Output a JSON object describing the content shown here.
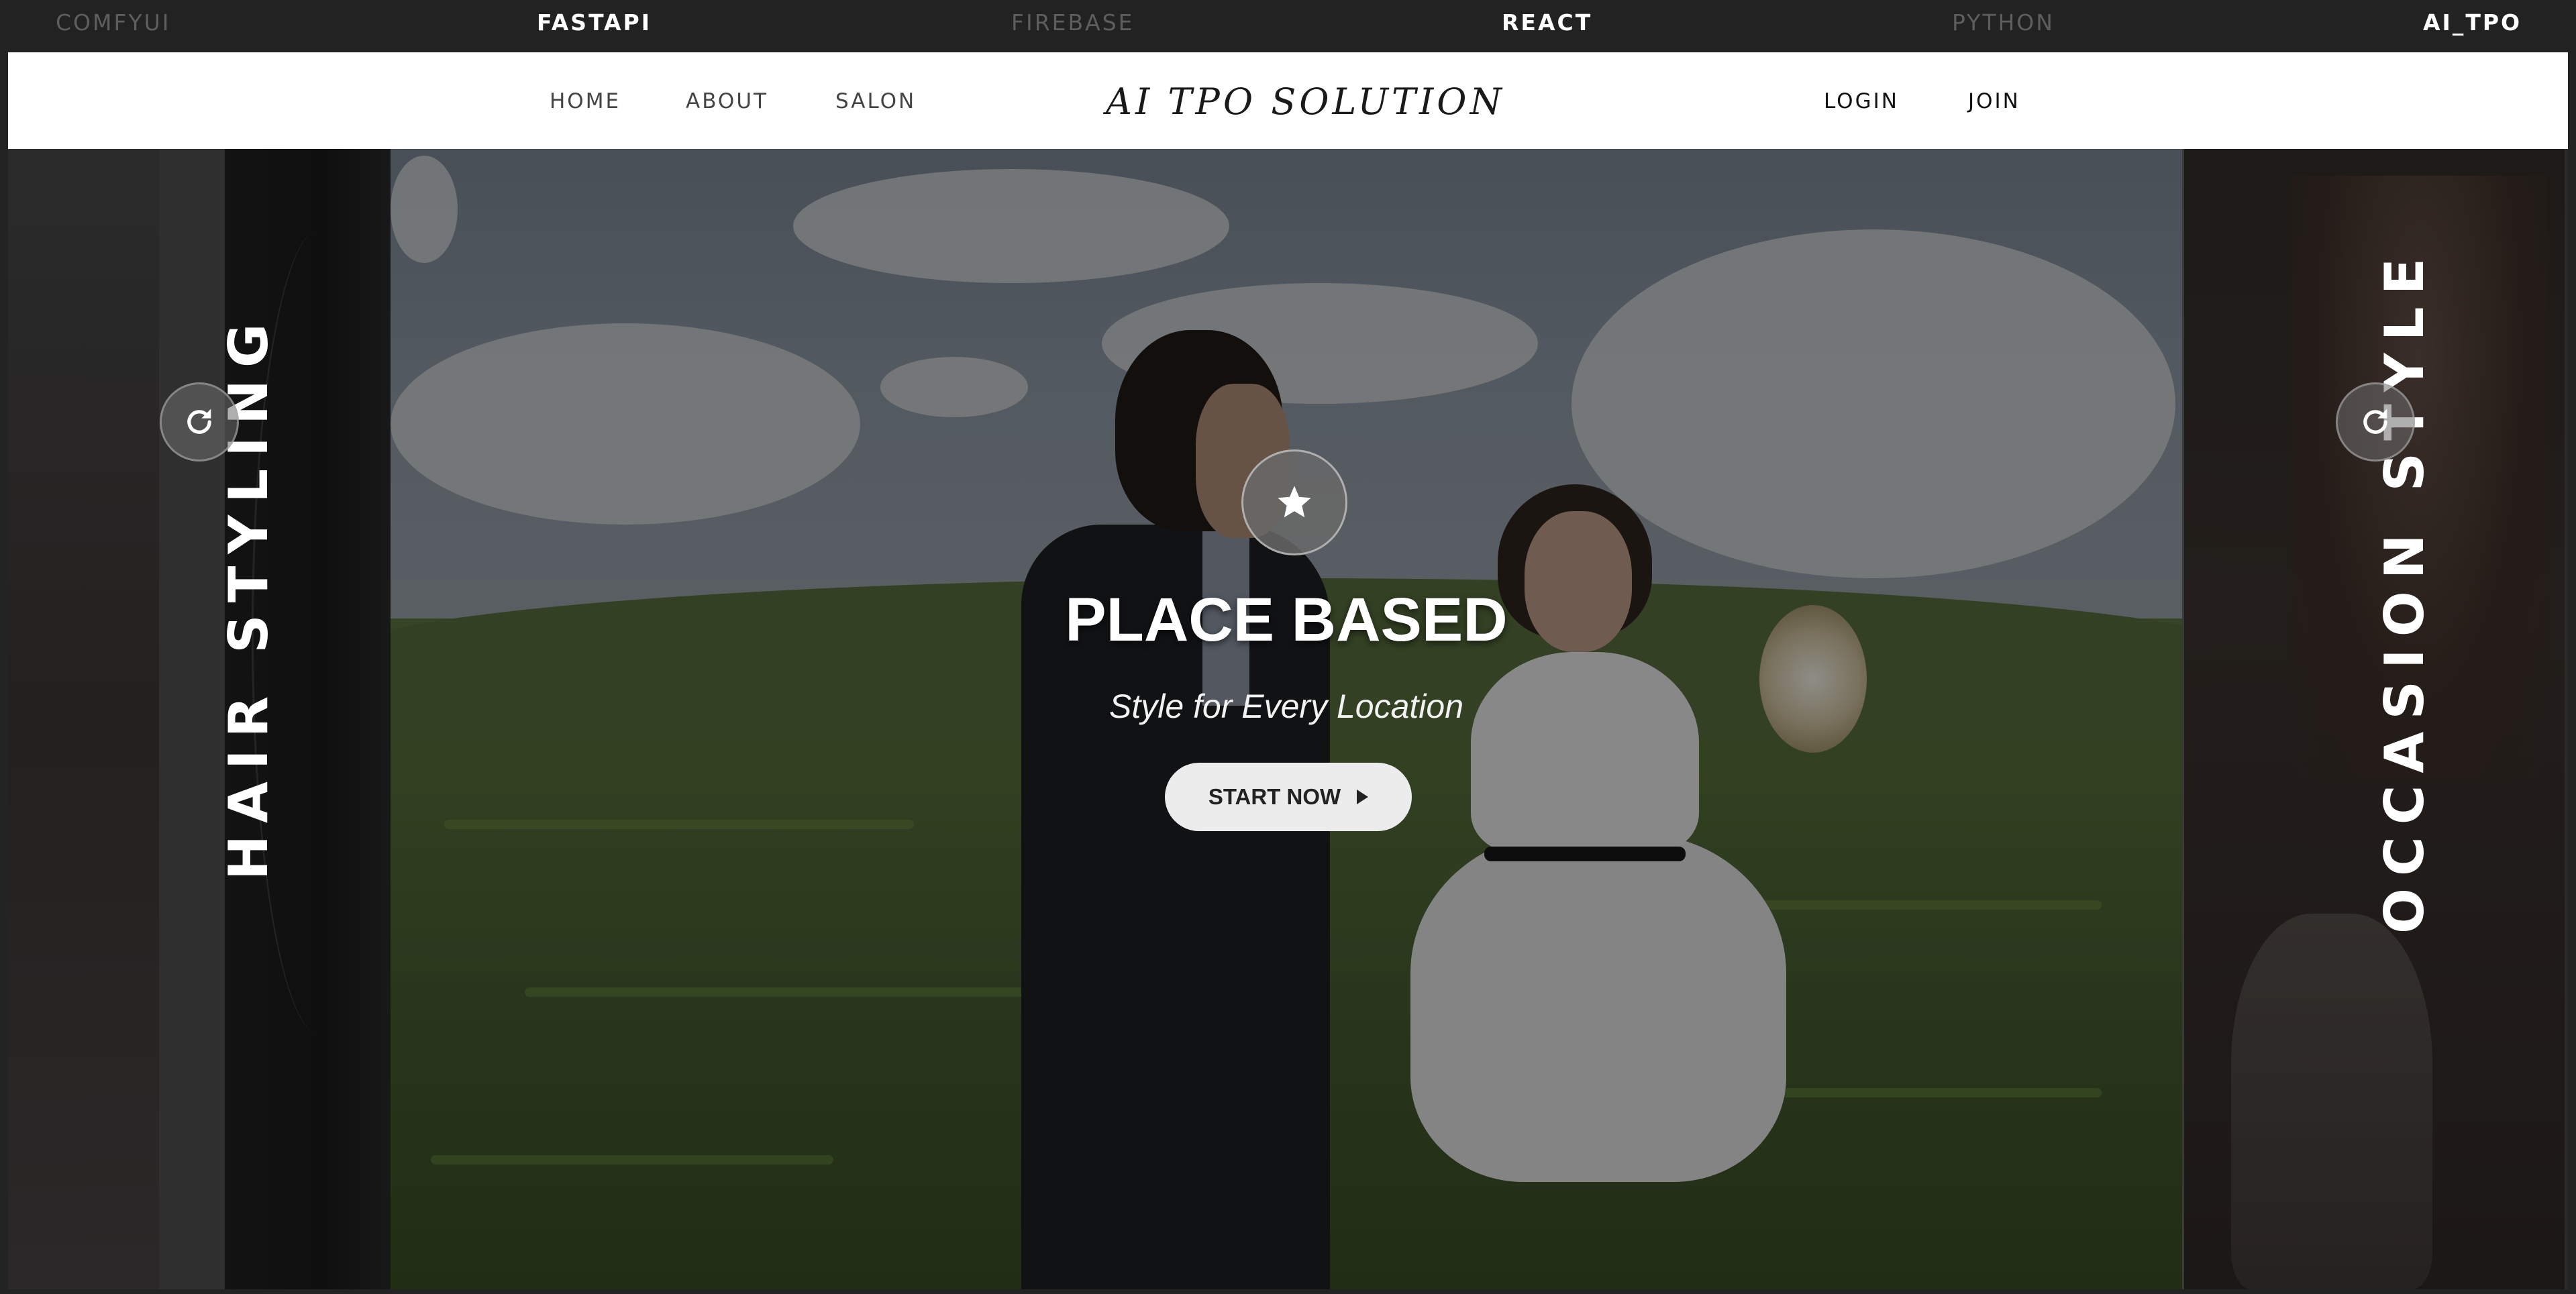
{
  "tech_strip": {
    "items": [
      {
        "label": "COMFYUI",
        "style": "dim"
      },
      {
        "label": "FASTAPI",
        "style": "bright"
      },
      {
        "label": "FIREBASE",
        "style": "dim"
      },
      {
        "label": "REACT",
        "style": "bright"
      },
      {
        "label": "PYTHON",
        "style": "dim"
      },
      {
        "label": "AI_TPO",
        "style": "bright"
      }
    ]
  },
  "navbar": {
    "left_links": [
      "HOME",
      "ABOUT",
      "SALON"
    ],
    "brand": "AI TPO SOLUTION",
    "right_links": [
      "LOGIN",
      "JOIN"
    ]
  },
  "panels": {
    "left_label": "HAIR STYLING",
    "right_label": "OCCASION STYLE",
    "nav_icon": "refresh-arrow-icon"
  },
  "hero": {
    "icon": "star-icon",
    "title": "PLACE BASED",
    "subtitle": "Style for Every Location",
    "cta_label": "START NOW",
    "cta_icon": "play-icon"
  },
  "colors": {
    "strip_bg": "#222222",
    "navbar_bg": "#ffffff",
    "cta_bg": "#ececec",
    "text_light": "#ffffff"
  }
}
